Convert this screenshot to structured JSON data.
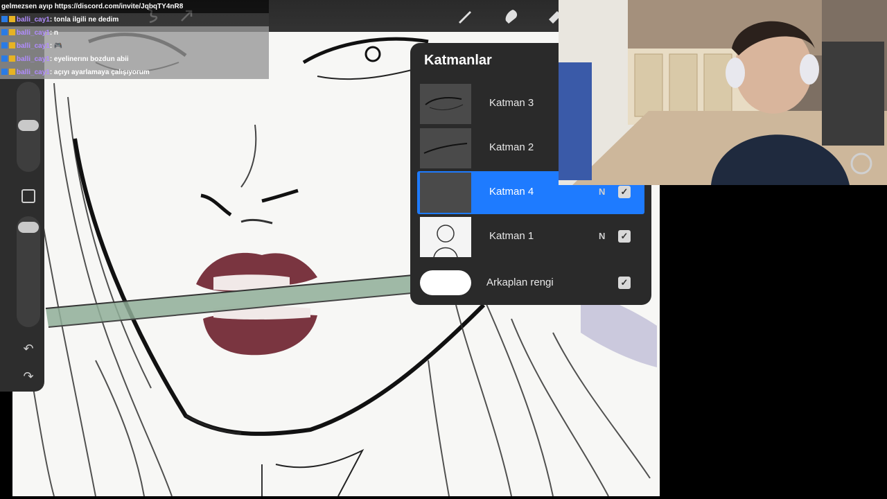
{
  "chat": {
    "header": "gelmezsen ayıp https://discord.com/invite/JqbqTY4nR8",
    "messages": [
      {
        "user": "balli_cay1",
        "text": ": tonla ilgili ne dedim"
      },
      {
        "user": "balli_cay1",
        "text": ": n"
      },
      {
        "user": "balli_cay1",
        "text": ": 🎮"
      },
      {
        "user": "balli_cay1",
        "text": ": eyelinerını bozdun abii"
      },
      {
        "user": "balli_cay1",
        "text": ": açıyı ayarlamaya çalışıyorum"
      }
    ]
  },
  "layers": {
    "title": "Katmanlar",
    "items": [
      {
        "name": "Katman 3",
        "mode": "",
        "visible": true,
        "active": false
      },
      {
        "name": "Katman 2",
        "mode": "",
        "visible": true,
        "active": false
      },
      {
        "name": "Katman 4",
        "mode": "N",
        "visible": true,
        "active": true
      },
      {
        "name": "Katman 1",
        "mode": "N",
        "visible": true,
        "active": false
      }
    ],
    "background": {
      "label": "Arkaplan rengi",
      "visible": true,
      "color": "#ffffff"
    }
  },
  "checkmark": "✓",
  "toolbar_icons": [
    "brush-icon",
    "smudge-icon",
    "eraser-icon",
    "selection-icon",
    "transform-icon"
  ],
  "sidebar": {
    "undo_glyph": "↶",
    "redo_glyph": "↷"
  },
  "colors": {
    "accent": "#1e7bff",
    "panel": "#2a2a2a",
    "lips": "#6b1f2c",
    "stem": "#7f9c86"
  }
}
